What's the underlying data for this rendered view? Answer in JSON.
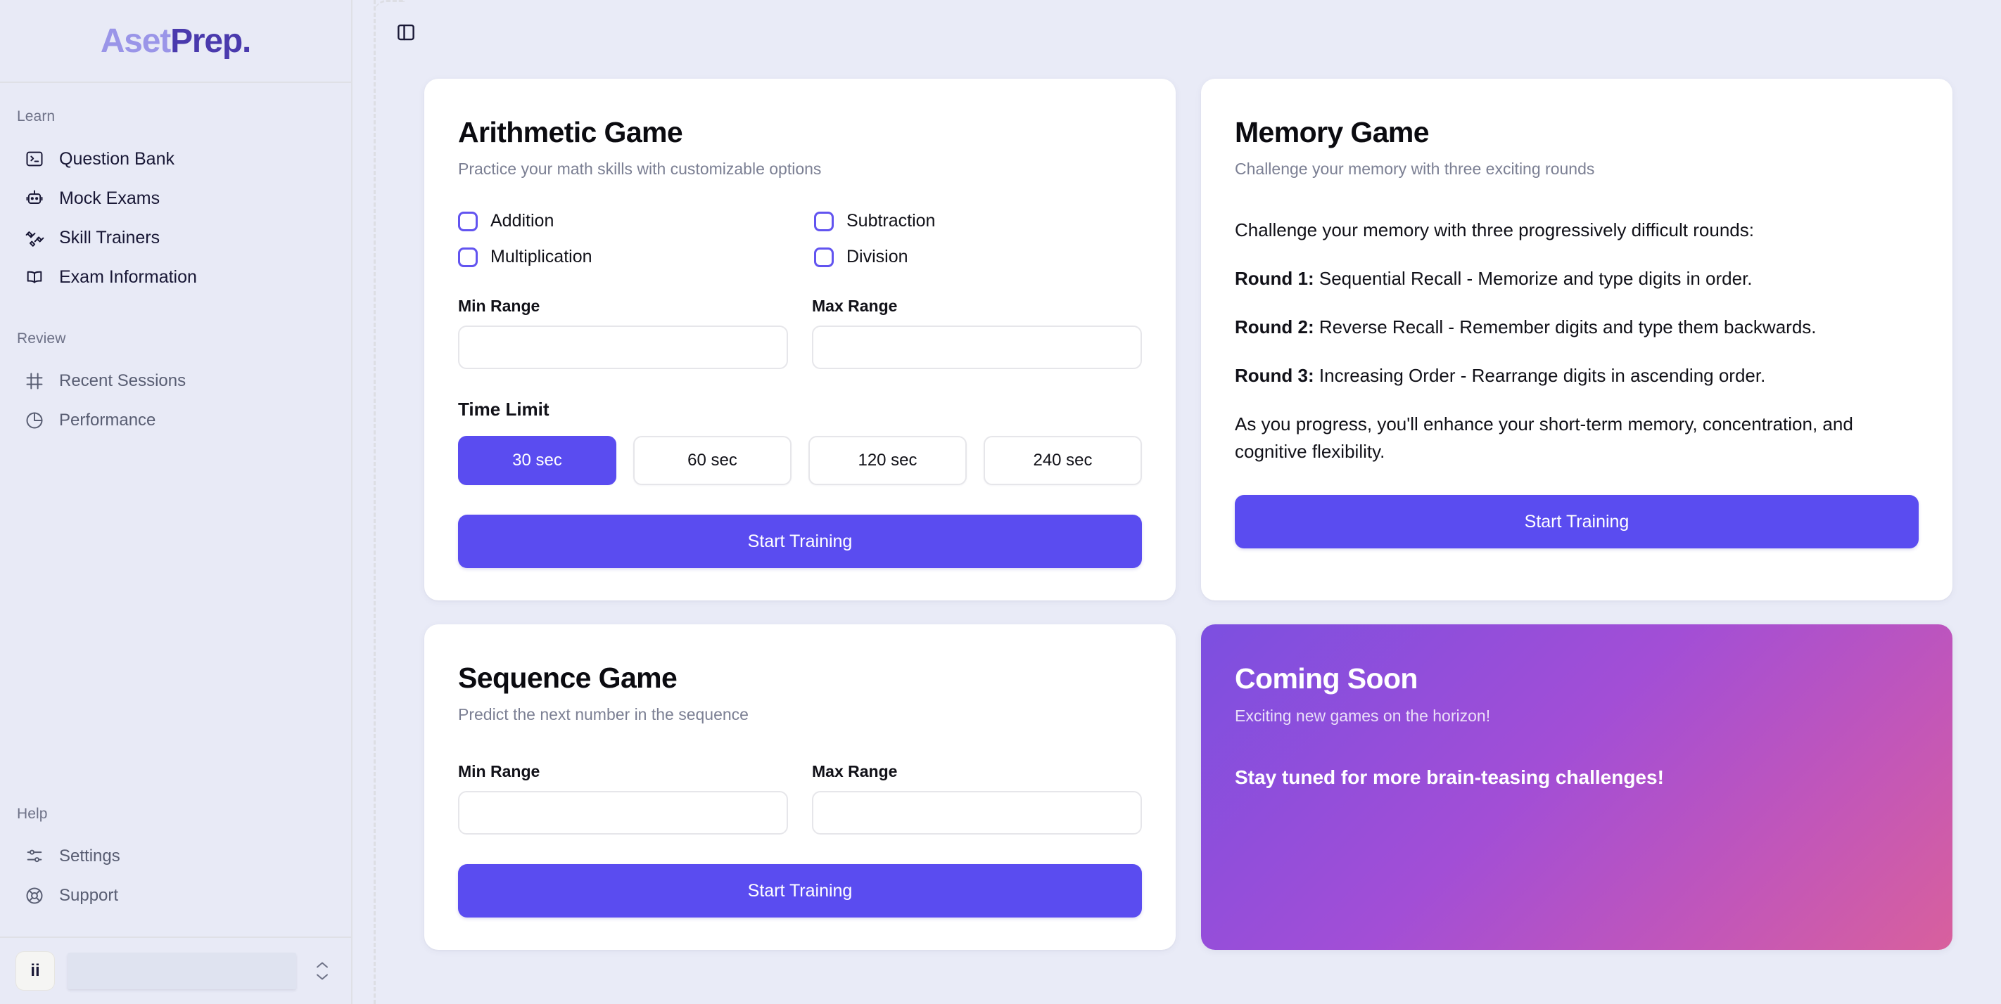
{
  "brand": {
    "part1": "Aset",
    "part2": "Prep."
  },
  "sidebar": {
    "sections": [
      {
        "label": "Learn",
        "items": [
          {
            "label": "Question Bank",
            "icon": "terminal-icon"
          },
          {
            "label": "Mock Exams",
            "icon": "robot-icon"
          },
          {
            "label": "Skill Trainers",
            "icon": "dumbbell-icon"
          },
          {
            "label": "Exam Information",
            "icon": "book-icon"
          }
        ]
      },
      {
        "label": "Review",
        "items": [
          {
            "label": "Recent Sessions",
            "icon": "frame-icon"
          },
          {
            "label": "Performance",
            "icon": "pie-chart-icon"
          }
        ]
      },
      {
        "label": "Help",
        "items": [
          {
            "label": "Settings",
            "icon": "sliders-icon"
          },
          {
            "label": "Support",
            "icon": "lifebuoy-icon"
          }
        ]
      }
    ],
    "footer": {
      "avatar_initials": "ii",
      "account_placeholder": ""
    }
  },
  "topbar": {
    "toggle_icon": "sidebar-panel-icon"
  },
  "colors": {
    "accent": "#5a4cf0",
    "checkbox_border": "#6254f0",
    "logo_light": "#9a95e8",
    "logo_dark": "#4a3aad",
    "page_bg": "#e9ebf7",
    "gradient_from": "#7c4fe0",
    "gradient_to": "#d8609d"
  },
  "arithmetic": {
    "title": "Arithmetic Game",
    "subtitle": "Practice your math skills with customizable options",
    "operations": [
      {
        "label": "Addition",
        "checked": false
      },
      {
        "label": "Subtraction",
        "checked": false
      },
      {
        "label": "Multiplication",
        "checked": false
      },
      {
        "label": "Division",
        "checked": false
      }
    ],
    "min_label": "Min Range",
    "min_value": "",
    "min_placeholder": "",
    "max_label": "Max Range",
    "max_value": "",
    "max_placeholder": "",
    "time_limit_label": "Time Limit",
    "time_options": [
      "30 sec",
      "60 sec",
      "120 sec",
      "240 sec"
    ],
    "time_selected": "30 sec",
    "start_label": "Start Training"
  },
  "memory": {
    "title": "Memory Game",
    "subtitle": "Challenge your memory with three exciting rounds",
    "intro": "Challenge your memory with three progressively difficult rounds:",
    "rounds": [
      {
        "name": "Round 1:",
        "text": " Sequential Recall - Memorize and type digits in order."
      },
      {
        "name": "Round 2:",
        "text": " Reverse Recall - Remember digits and type them backwards."
      },
      {
        "name": "Round 3:",
        "text": " Increasing Order - Rearrange digits in ascending order."
      }
    ],
    "outro": "As you progress, you'll enhance your short-term memory, concentration, and cognitive flexibility.",
    "start_label": "Start Training"
  },
  "sequence": {
    "title": "Sequence Game",
    "subtitle": "Predict the next number in the sequence",
    "min_label": "Min Range",
    "min_value": "",
    "min_placeholder": "",
    "max_label": "Max Range",
    "max_value": "",
    "max_placeholder": "",
    "start_label": "Start Training"
  },
  "coming_soon": {
    "title": "Coming Soon",
    "subtitle": "Exciting new games on the horizon!",
    "tagline": "Stay tuned for more brain-teasing challenges!"
  }
}
